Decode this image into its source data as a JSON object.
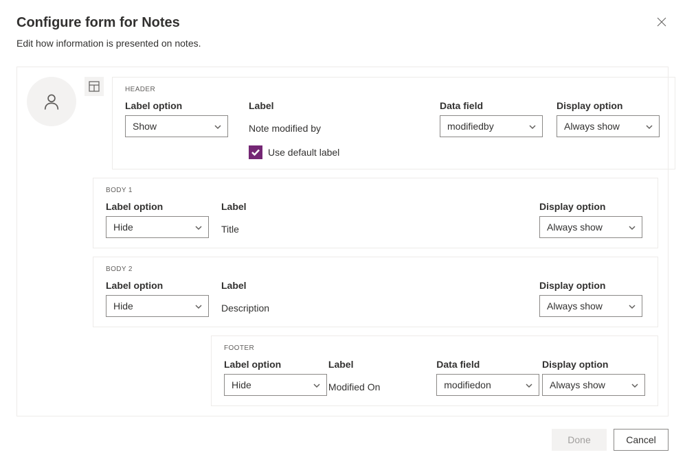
{
  "title": "Configure form for Notes",
  "subtitle": "Edit how information is presented on notes.",
  "labels": {
    "label_option": "Label option",
    "label": "Label",
    "data_field": "Data field",
    "display_option": "Display option",
    "use_default_label": "Use default label"
  },
  "options": {
    "show": "Show",
    "hide": "Hide",
    "always_show": "Always show"
  },
  "sections": {
    "header": {
      "name": "HEADER",
      "label_option_value": "Show",
      "label_value": "Note modified by",
      "data_field_value": "modifiedby",
      "display_option_value": "Always show",
      "use_default_label_checked": true
    },
    "body1": {
      "name": "BODY 1",
      "label_option_value": "Hide",
      "label_value": "Title",
      "display_option_value": "Always show"
    },
    "body2": {
      "name": "BODY 2",
      "label_option_value": "Hide",
      "label_value": "Description",
      "display_option_value": "Always show"
    },
    "footer": {
      "name": "FOOTER",
      "label_option_value": "Hide",
      "label_value": "Modified On",
      "data_field_value": "modifiedon",
      "display_option_value": "Always show"
    }
  },
  "buttons": {
    "done": "Done",
    "cancel": "Cancel"
  }
}
